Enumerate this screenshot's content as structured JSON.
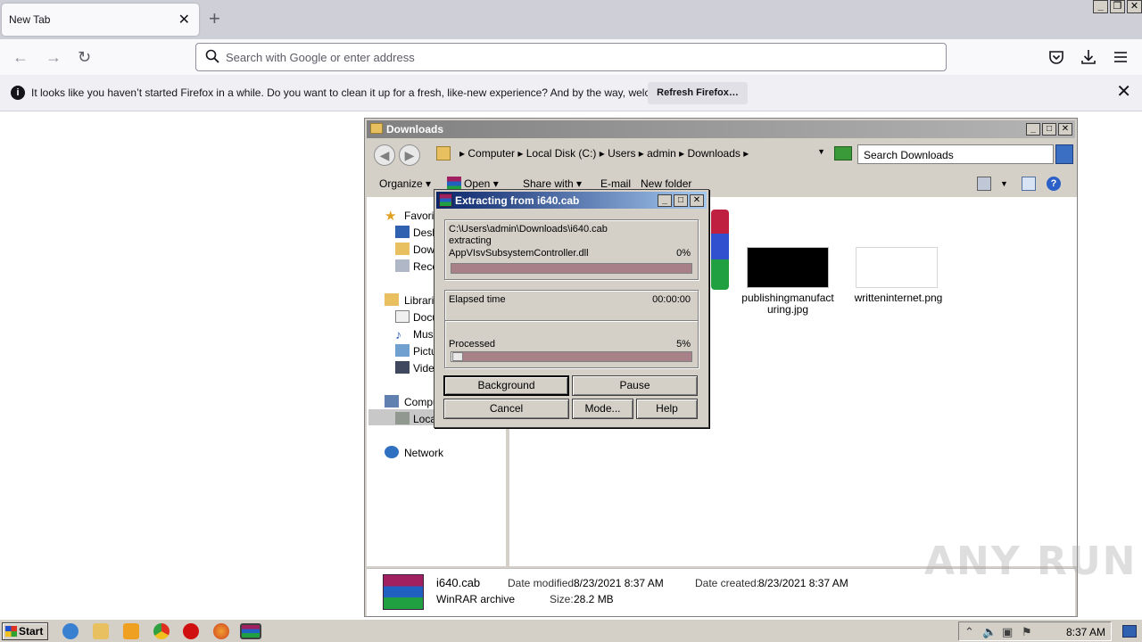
{
  "firefox": {
    "tab_title": "New Tab",
    "url_placeholder": "Search with Google or enter address",
    "notification": {
      "message": "It looks like you haven’t started Firefox in a while. Do you want to clean it up for a fresh, like-new experience? And by the way, welcome back!",
      "button": "Refresh Firefox…"
    }
  },
  "explorer": {
    "title": "Downloads",
    "breadcrumb": "▸  Computer  ▸  Local Disk (C:)  ▸  Users  ▸  admin  ▸  Downloads  ▸",
    "search_placeholder": "Search Downloads",
    "commands": {
      "organize": "Organize ▾",
      "open": "Open ▾",
      "share": "Share with ▾",
      "email": "E-mail",
      "new_folder": "New folder"
    },
    "nav": {
      "favorites": "Favori",
      "desktop": "Desk",
      "downloads": "Dow",
      "recent": "Rece",
      "libraries": "Librarie",
      "documents": "Docu",
      "music": "Musi",
      "pictures": "Pictu",
      "videos": "Vide",
      "computer": "Compu",
      "local": "Loca",
      "network": "Network"
    },
    "files": [
      {
        "label1": "publishingmanufact",
        "label2": "uring.jpg"
      },
      {
        "label1": "writteninternet.png",
        "label2": ""
      }
    ],
    "details": {
      "name": "i640.cab",
      "type": "WinRAR archive",
      "modified_label": "Date modified:",
      "modified": "8/23/2021 8:37 AM",
      "size_label": "Size:",
      "size": "28.2 MB",
      "created_label": "Date created:",
      "created": "8/23/2021 8:37 AM"
    }
  },
  "winrar": {
    "title": "Extracting from i640.cab",
    "path": "C:\\Users\\admin\\Downloads\\i640.cab",
    "action": "extracting",
    "current_file": "AppVIsvSubsystemController.dll",
    "file_percent": "0%",
    "file_progress": 1.0,
    "elapsed_label": "Elapsed time",
    "elapsed": "00:00:00",
    "processed_label": "Processed",
    "processed_percent": "5%",
    "processed_progress": 0.05,
    "buttons": {
      "background": "Background",
      "pause": "Pause",
      "cancel": "Cancel",
      "mode": "Mode...",
      "help": "Help"
    }
  },
  "taskbar": {
    "start": "Start",
    "clock": "8:37 AM"
  },
  "watermark": "ANY RUN"
}
